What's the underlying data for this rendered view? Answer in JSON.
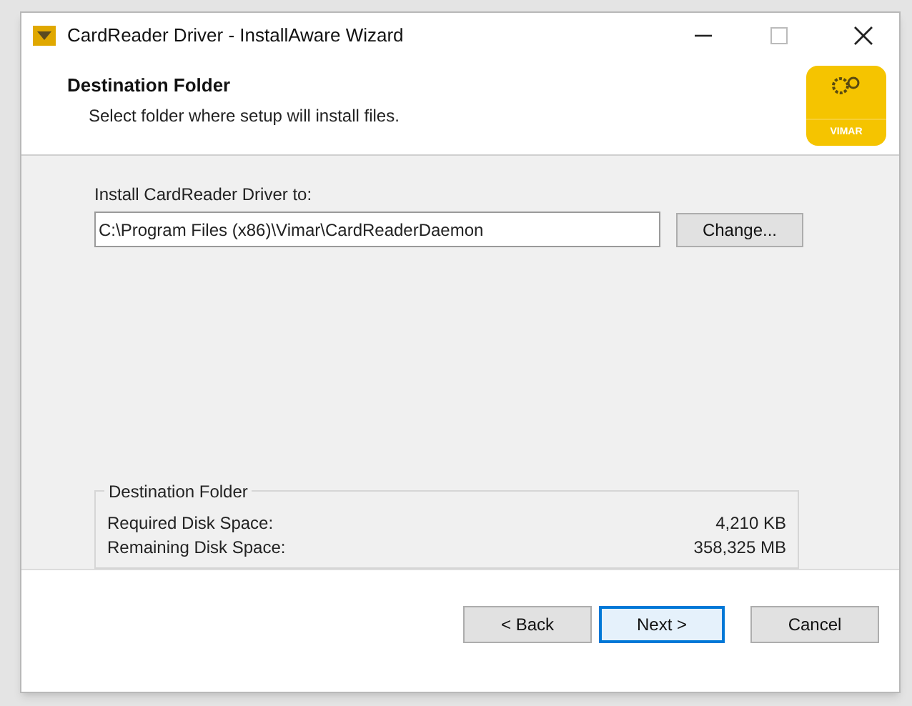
{
  "window": {
    "title": "CardReader Driver - InstallAware Wizard"
  },
  "header": {
    "title": "Destination Folder",
    "subtitle": "Select folder where setup will install files.",
    "logo_text": "VIMAR"
  },
  "install_path": {
    "label": "Install CardReader Driver to:",
    "value": "C:\\Program Files (x86)\\Vimar\\CardReaderDaemon",
    "change_button": "Change..."
  },
  "disk_space": {
    "title": "Destination Folder",
    "rows": [
      {
        "label": "Required Disk Space:",
        "value": "4,210 KB"
      },
      {
        "label": "Remaining Disk Space:",
        "value": "358,325 MB"
      }
    ]
  },
  "buttons": [
    {
      "label": "< Back",
      "default": false
    },
    {
      "label": "Next >",
      "default": true
    },
    {
      "label": "Cancel",
      "default": false
    }
  ]
}
